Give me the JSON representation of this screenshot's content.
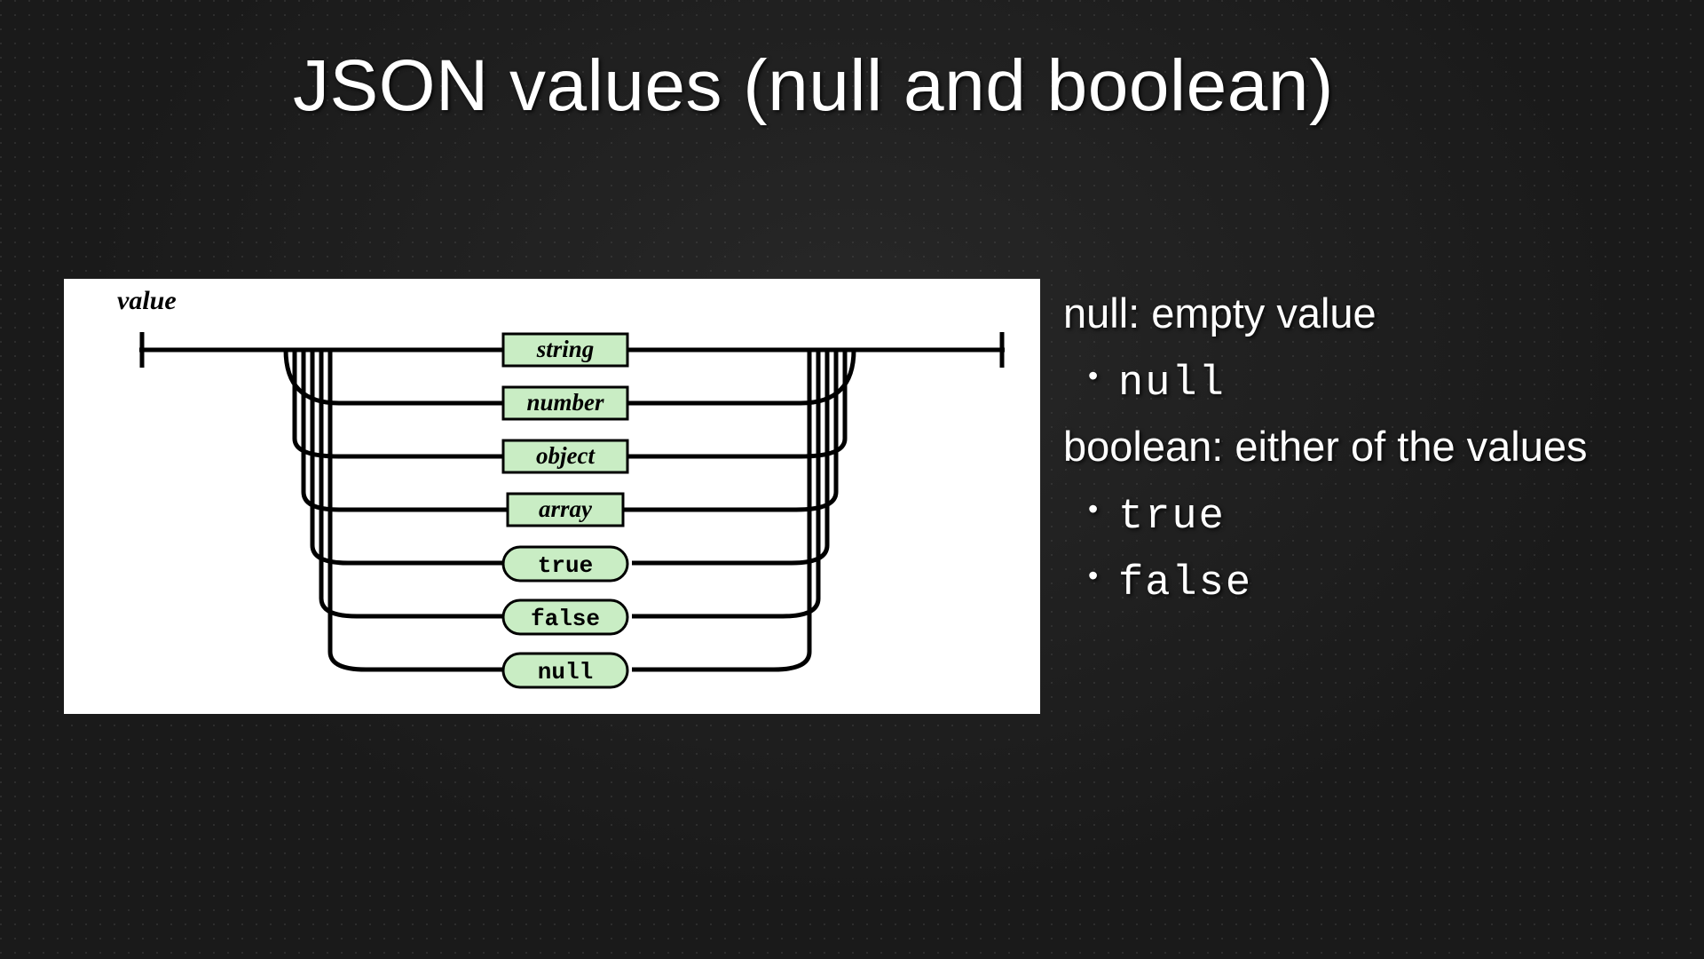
{
  "title": "JSON values (null and boolean)",
  "diagram": {
    "title": "value",
    "items": [
      {
        "label": "string",
        "shape": "rect"
      },
      {
        "label": "number",
        "shape": "rect"
      },
      {
        "label": "object",
        "shape": "rect"
      },
      {
        "label": "array",
        "shape": "rect"
      },
      {
        "label": "true",
        "shape": "pill"
      },
      {
        "label": "false",
        "shape": "pill"
      },
      {
        "label": "null",
        "shape": "pill"
      }
    ]
  },
  "notes": {
    "null_heading": "null: empty value",
    "null_code": "null",
    "bool_heading": "boolean: either of the values",
    "bool_true": "true",
    "bool_false": "false"
  }
}
